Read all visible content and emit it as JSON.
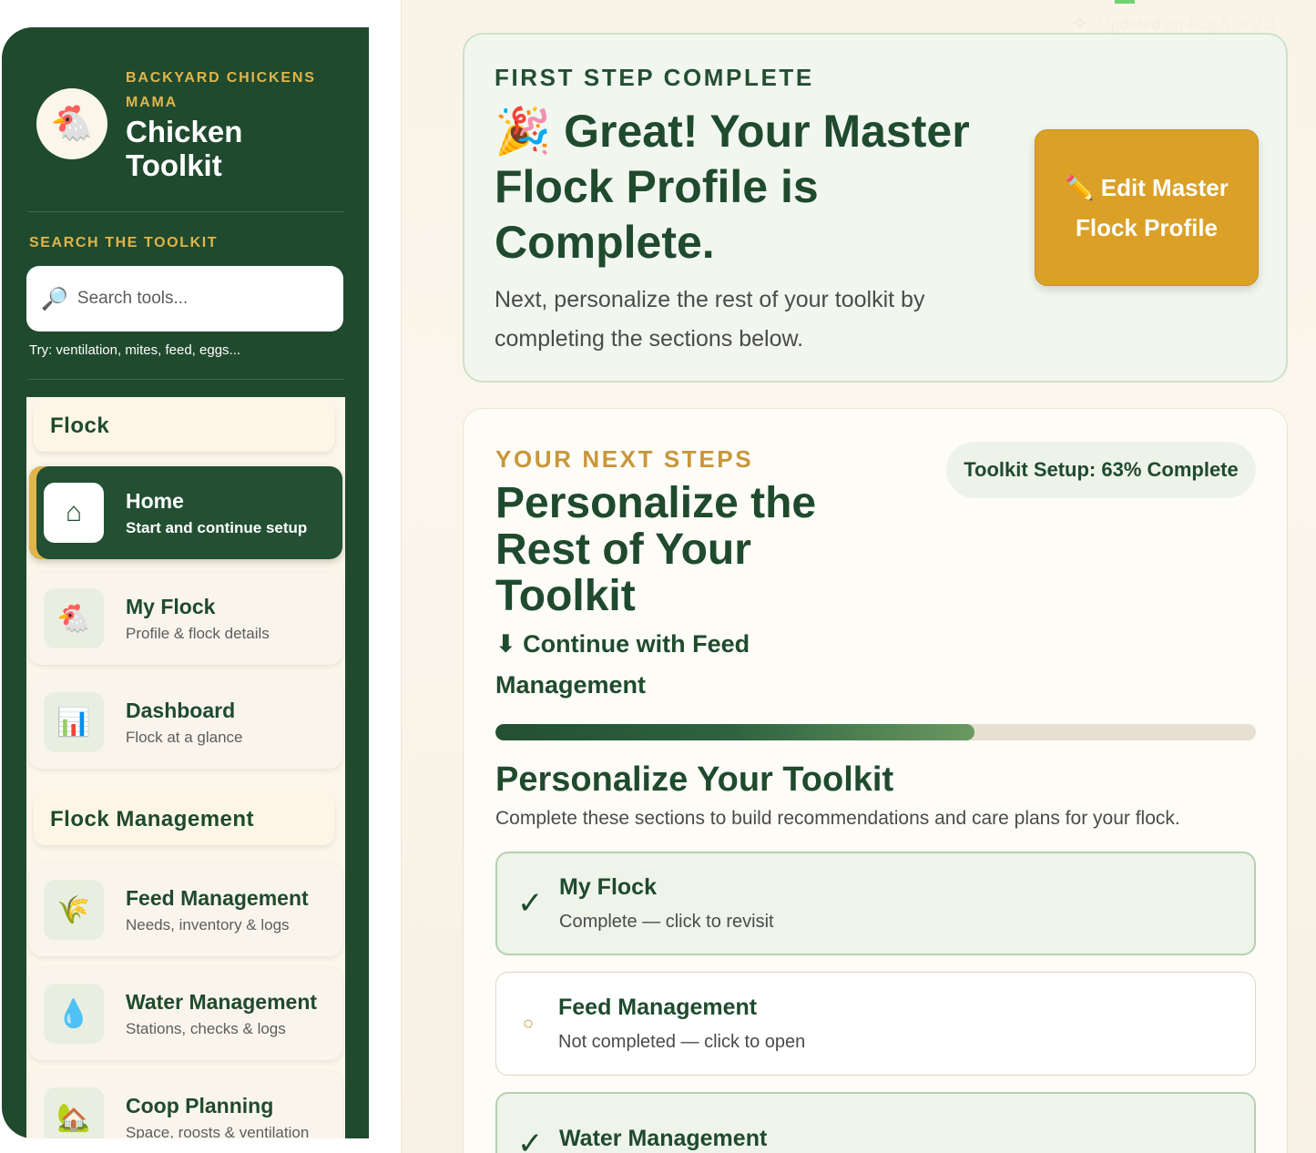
{
  "status": {
    "updated_text": "Updated on Aug 5 at 2:3"
  },
  "sidebar": {
    "brand_sub": "BACKYARD CHICKENS MAMA",
    "brand_title": "Chicken Toolkit",
    "brand_icon": "🐔",
    "search_label": "SEARCH THE TOOLKIT",
    "search_placeholder": "Search tools...",
    "search_hint": "Try: ventilation, mites, feed, eggs...",
    "sections": [
      {
        "title": "Flock",
        "items": [
          {
            "icon": "⌂",
            "title": "Home",
            "subtitle": "Start and continue setup",
            "active": true
          },
          {
            "icon": "🐔",
            "title": "My Flock",
            "subtitle": "Profile & flock details"
          },
          {
            "icon": "📊",
            "title": "Dashboard",
            "subtitle": "Flock at a glance"
          }
        ]
      },
      {
        "title": "Flock Management",
        "items": [
          {
            "icon": "🌾",
            "title": "Feed Management",
            "subtitle": "Needs, inventory & logs"
          },
          {
            "icon": "💧",
            "title": "Water Management",
            "subtitle": "Stations, checks & logs"
          },
          {
            "icon": "🏡",
            "title": "Coop Planning",
            "subtitle": "Space, roosts & ventilation"
          }
        ]
      }
    ]
  },
  "hero": {
    "eyebrow": "FIRST STEP COMPLETE",
    "title": "🎉 Great! Your Master Flock Profile is Complete.",
    "description": "Next, personalize the rest of your toolkit by completing the sections below.",
    "edit_button": "✏️ Edit Master Flock Profile"
  },
  "next_steps": {
    "eyebrow": "YOUR NEXT STEPS",
    "badge": "Toolkit Setup: 63% Complete",
    "progress": 0.63,
    "title": "Personalize the Rest of Your Toolkit",
    "continue_link": "⬇ Continue with Feed Management",
    "section_title": "Personalize Your Toolkit",
    "section_subtitle": "Complete these sections to build recommendations and care plans for your flock.",
    "sections": [
      {
        "title": "My Flock",
        "subtitle": "Complete — click to revisit",
        "status": "done",
        "mark": "✓"
      },
      {
        "title": "Feed Management",
        "subtitle": "Not completed — click to open",
        "status": "todo",
        "mark": "○"
      },
      {
        "title": "Water Management",
        "subtitle": "",
        "status": "done",
        "mark": "✓"
      }
    ]
  },
  "colors": {
    "sidebar_green": "#1f4a2e",
    "accent_gold": "#daa027",
    "eyebrow_gold": "#c8973b"
  }
}
